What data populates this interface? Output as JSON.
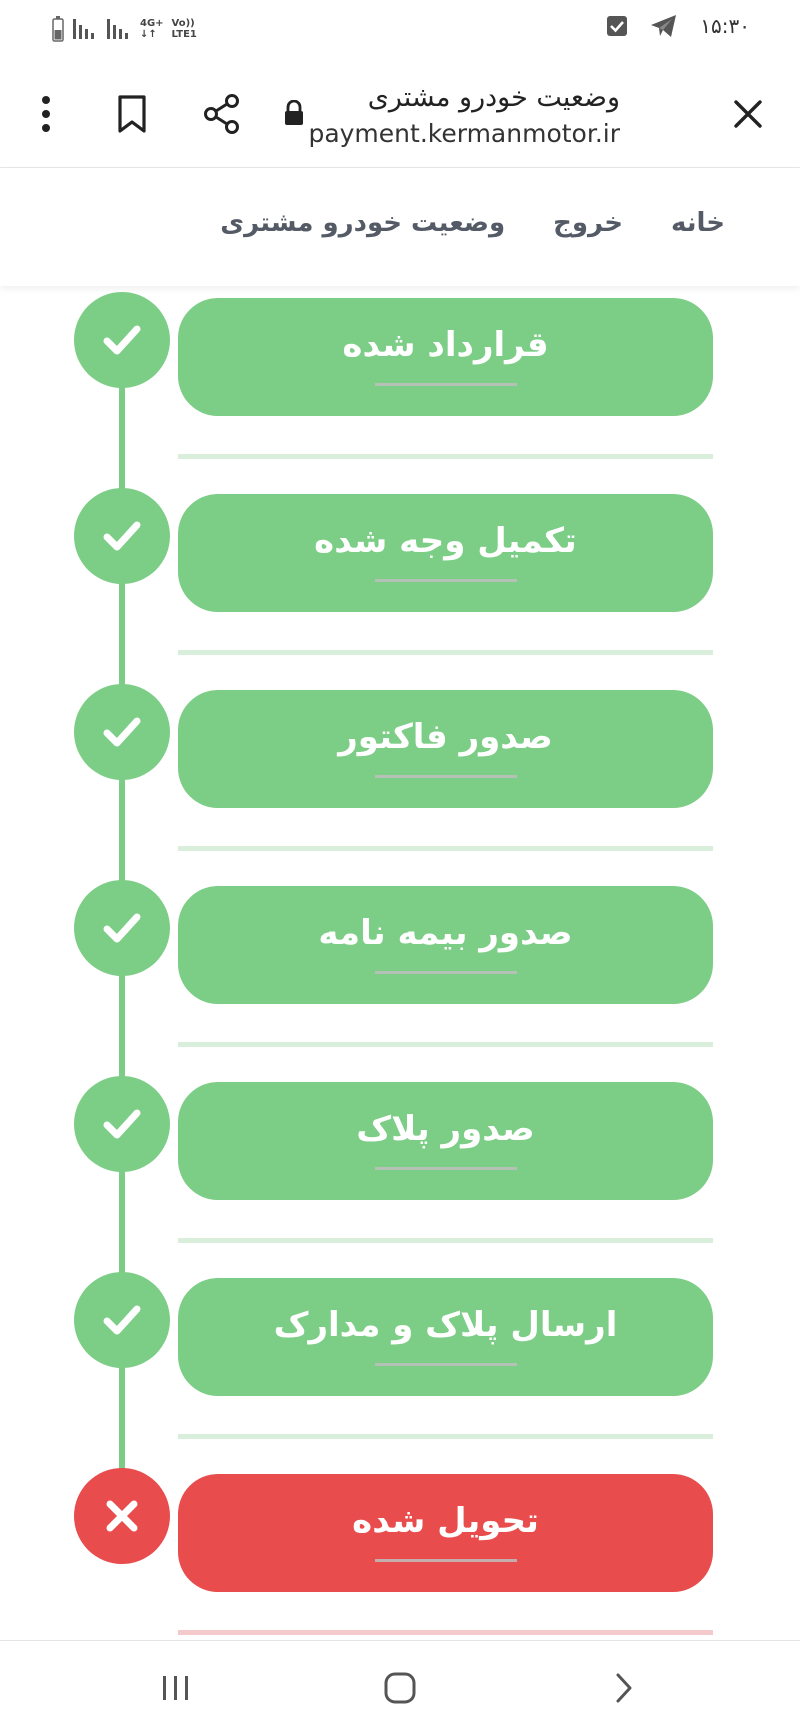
{
  "status_bar": {
    "time": "۱۵:۳۰",
    "network_type": "4G+",
    "lte_label": "LTE1",
    "volte_label": "Vo))",
    "icons": [
      "battery-icon",
      "signal-icon",
      "signal-icon",
      "checkbox-notification-icon",
      "telegram-icon"
    ]
  },
  "browser": {
    "page_title": "وضعیت خودرو مشتری",
    "url": "payment.kermanmotor.ir",
    "icons": [
      "close-icon",
      "lock-icon",
      "share-icon",
      "bookmark-icon",
      "more-vert-icon"
    ]
  },
  "nav": {
    "items": [
      {
        "label": "خانه"
      },
      {
        "label": "خروج"
      },
      {
        "label": "وضعیت خودرو مشتری"
      }
    ]
  },
  "timeline": {
    "colors": {
      "done": "#7ccd86",
      "failed": "#e84c4c",
      "line": "#7ccb87"
    },
    "steps": [
      {
        "label": "قرارداد شده",
        "status": "done",
        "icon": "check-icon"
      },
      {
        "label": "تکمیل وجه شده",
        "status": "done",
        "icon": "check-icon"
      },
      {
        "label": "صدور فاکتور",
        "status": "done",
        "icon": "check-icon"
      },
      {
        "label": "صدور بیمه نامه",
        "status": "done",
        "icon": "check-icon"
      },
      {
        "label": "صدور پلاک",
        "status": "done",
        "icon": "check-icon"
      },
      {
        "label": "ارسال پلاک و مدارک",
        "status": "done",
        "icon": "check-icon"
      },
      {
        "label": "تحویل شده",
        "status": "failed",
        "icon": "x-icon"
      }
    ]
  },
  "system_nav": {
    "icons": [
      "recent-apps-icon",
      "home-icon",
      "back-icon"
    ]
  }
}
